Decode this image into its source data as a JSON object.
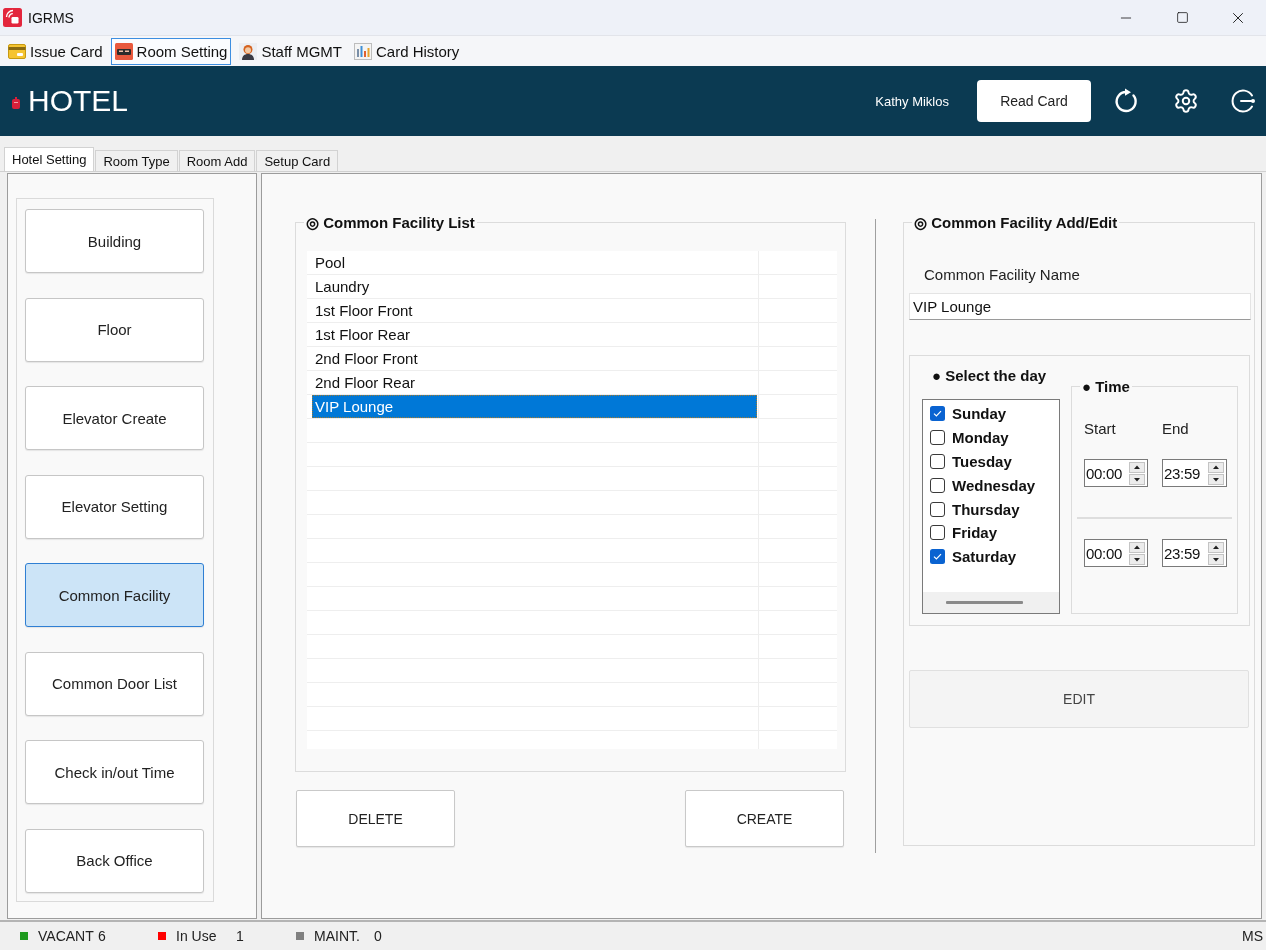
{
  "window": {
    "title": "IGRMS"
  },
  "toolbar": [
    {
      "label": "Issue Card",
      "selected": false
    },
    {
      "label": "Room Setting",
      "selected": true
    },
    {
      "label": "Staff MGMT",
      "selected": false
    },
    {
      "label": "Card History",
      "selected": false
    }
  ],
  "header": {
    "brand": "HOTEL",
    "user": "Kathy Miklos",
    "read_card_button": "Read Card"
  },
  "tabs": [
    {
      "label": "Hotel Setting",
      "selected": true
    },
    {
      "label": "Room Type",
      "selected": false
    },
    {
      "label": "Room Add",
      "selected": false
    },
    {
      "label": "Setup Card",
      "selected": false
    }
  ],
  "sidebar": {
    "items": [
      {
        "label": "Building",
        "selected": false
      },
      {
        "label": "Floor",
        "selected": false
      },
      {
        "label": "Elevator Create",
        "selected": false
      },
      {
        "label": "Elevator Setting",
        "selected": false
      },
      {
        "label": "Common Facility",
        "selected": true
      },
      {
        "label": "Common Door List",
        "selected": false
      },
      {
        "label": "Check in/out Time",
        "selected": false
      },
      {
        "label": "Back Office",
        "selected": false
      }
    ]
  },
  "facility_list": {
    "title": "◎ Common Facility List",
    "rows": [
      {
        "name": "Pool",
        "selected": false
      },
      {
        "name": "Laundry",
        "selected": false
      },
      {
        "name": "1st Floor Front",
        "selected": false
      },
      {
        "name": "1st Floor Rear",
        "selected": false
      },
      {
        "name": "2nd Floor Front",
        "selected": false
      },
      {
        "name": "2nd Floor Rear",
        "selected": false
      },
      {
        "name": "VIP Lounge",
        "selected": true
      }
    ],
    "delete_button": "DELETE",
    "create_button": "CREATE"
  },
  "facility_edit": {
    "title": "◎ Common Facility Add/Edit",
    "name_label": "Common Facility Name",
    "name_value": "VIP Lounge",
    "day_title": "● Select the day",
    "days": [
      {
        "label": "Sunday",
        "checked": true
      },
      {
        "label": "Monday",
        "checked": false
      },
      {
        "label": "Tuesday",
        "checked": false
      },
      {
        "label": "Wednesday",
        "checked": false
      },
      {
        "label": "Thursday",
        "checked": false
      },
      {
        "label": "Friday",
        "checked": false
      },
      {
        "label": "Saturday",
        "checked": true
      }
    ],
    "time_title": "● Time",
    "start_label": "Start",
    "end_label": "End",
    "times": [
      {
        "start": "00:00",
        "end": "23:59"
      },
      {
        "start": "00:00",
        "end": "23:59"
      }
    ],
    "edit_button": "EDIT"
  },
  "status_bar": {
    "items": [
      {
        "label": "VACANT",
        "count": "6",
        "color": "#1e9a1e"
      },
      {
        "label": "In Use",
        "count": "1",
        "color": "#ff0000"
      },
      {
        "label": "MAINT.",
        "count": "0",
        "color": "#808080"
      }
    ],
    "right_text": "MS"
  }
}
